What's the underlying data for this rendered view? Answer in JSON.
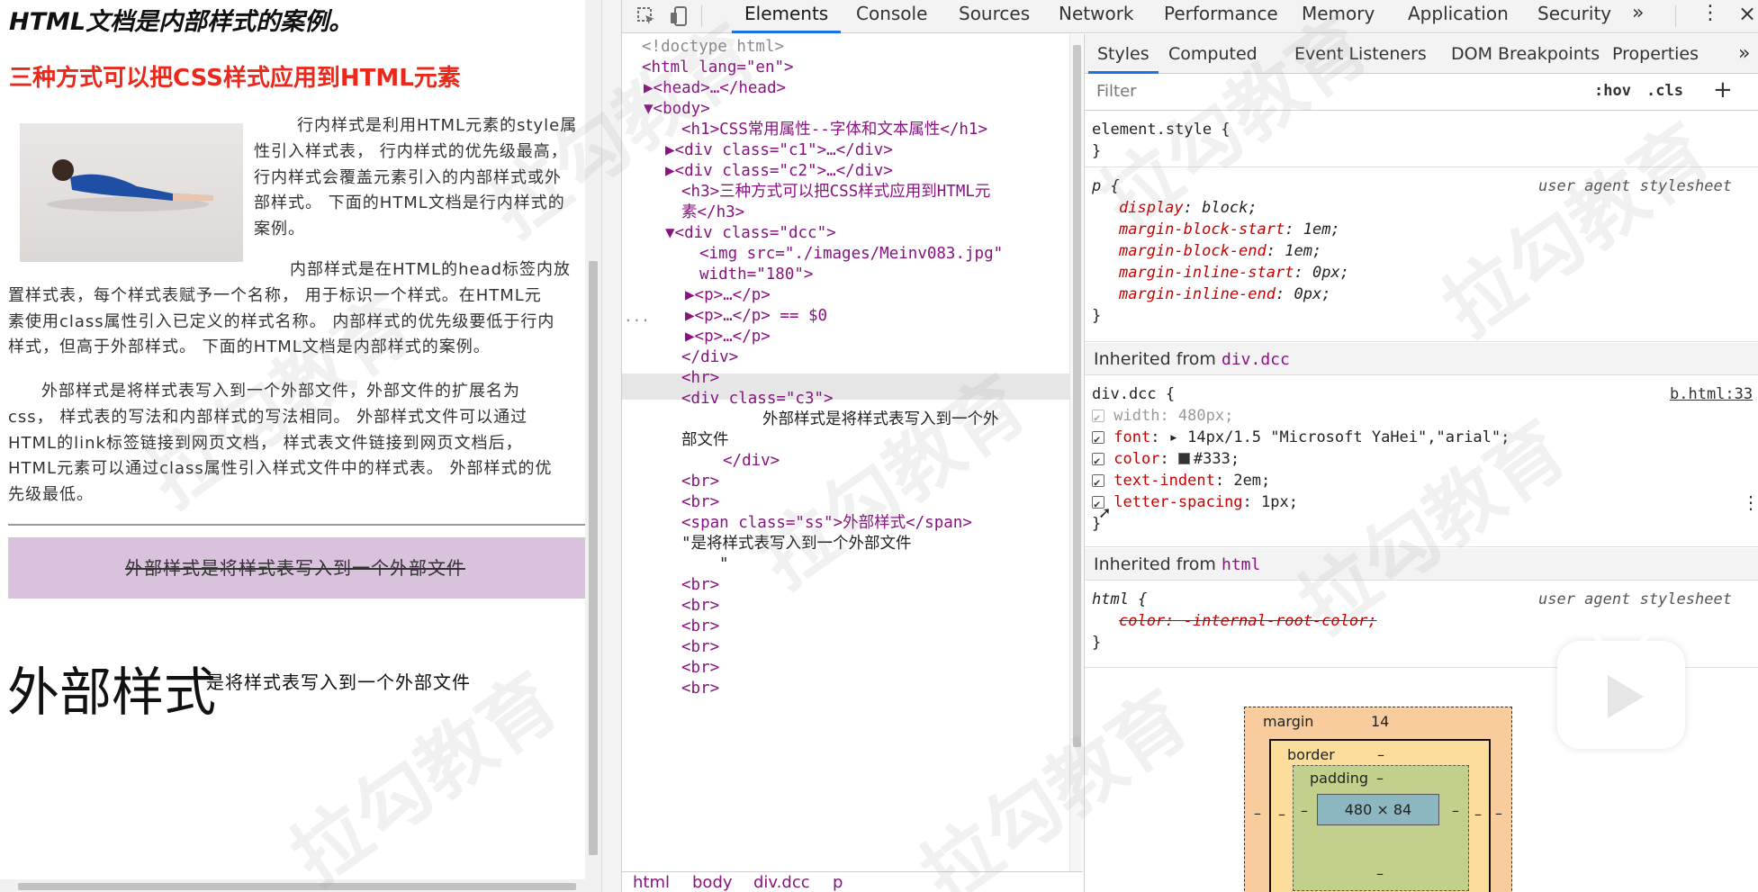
{
  "page": {
    "h1": "HTML文档是内部样式的案例。",
    "h3": "三种方式可以把CSS样式应用到HTML元素",
    "p1_lines": [
      "行内样式是利用HTML元素的style属",
      "性引入样式表， 行内样式的优先级最高，",
      "行内样式会覆盖元素引入的内部样式或外",
      "部样式。 下面的HTML文档是行内样式的",
      "案例。"
    ],
    "p2_lines": [
      "内部样式是在HTML的head标签内放",
      "置样式表，每个样式表赋予一个名称， 用于标识一个样式。在HTML元",
      "素使用class属性引入已定义的样式名称。 内部样式的优先级要低于行内",
      "样式，但高于外部样式。 下面的HTML文档是内部样式的案例。"
    ],
    "p3_lines": [
      "外部样式是将样式表写入到一个外部文件，外部文件的扩展名为",
      "css， 样式表的写法和内部样式的写法相同。 外部样式文件可以通过",
      "HTML的link标签链接到网页文档， 样式表文件链接到网页文档后，",
      "HTML元素可以通过class属性引入样式文件中的样式表。 外部样式的优",
      "先级最低。"
    ],
    "c3_text": "外部样式是将样式表写入到一个外部文件",
    "big_span": "外部样式",
    "big_after": "是将样式表写入到一个外部文件"
  },
  "toolbar": {
    "tabs": [
      "Elements",
      "Console",
      "Sources",
      "Network",
      "Performance",
      "Memory",
      "Application",
      "Security"
    ],
    "more": "»",
    "menu": "⋮",
    "close": "×"
  },
  "elements": {
    "lines": [
      {
        "t": "<!doctype html>",
        "cls": "cmt"
      },
      {
        "t": "<html lang=\"en\">"
      },
      {
        "t": "▶<head>…</head>"
      },
      {
        "t": "▼<body>"
      },
      {
        "t": "<h1>CSS常用属性--字体和文本属性</h1>"
      },
      {
        "t": "▶<div class=\"c1\">…</div>"
      },
      {
        "t": "▶<div class=\"c2\">…</div>"
      },
      {
        "t": "<h3>三种方式可以把CSS样式应用到HTML元"
      },
      {
        "t": "素</h3>"
      },
      {
        "t": "▼<div class=\"dcc\">"
      },
      {
        "t": "<img src=\"./images/Meinv083.jpg\""
      },
      {
        "t": "width=\"180\">"
      },
      {
        "t": "▶<p>…</p>"
      },
      {
        "t": "▶<p>…</p> == $0"
      },
      {
        "t": "▶<p>…</p>"
      },
      {
        "t": "</div>"
      },
      {
        "t": "<hr>"
      },
      {
        "t": "<div class=\"c3\">"
      },
      {
        "t": "外部样式是将样式表写入到一个外"
      },
      {
        "t": "部文件"
      },
      {
        "t": "</div>"
      },
      {
        "t": "<br>"
      },
      {
        "t": "<br>"
      },
      {
        "t": "<span class=\"ss\">外部样式</span>"
      },
      {
        "t": "\"是将样式表写入到一个外部文件"
      },
      {
        "t": "\""
      },
      {
        "t": "<br>"
      },
      {
        "t": "<br>"
      },
      {
        "t": "<br>"
      },
      {
        "t": "<br>"
      },
      {
        "t": "<br>"
      },
      {
        "t": "<br>"
      }
    ],
    "dots": "...",
    "crumbs": [
      "html",
      "body",
      "div.dcc",
      "p"
    ]
  },
  "styles": {
    "subtabs": [
      "Styles",
      "Computed",
      "Event Listeners",
      "DOM Breakpoints",
      "Properties"
    ],
    "subtabs_more": "»",
    "filter_placeholder": "Filter",
    "hov": ":hov",
    "cls": ".cls",
    "plus": "+",
    "element_style": "element.style {",
    "close_brace": "}",
    "p_rule_sel": "p {",
    "uas": "user agent stylesheet",
    "p_props": [
      {
        "name": "display",
        "value": "block;"
      },
      {
        "name": "margin-block-start",
        "value": "1em;"
      },
      {
        "name": "margin-block-end",
        "value": "1em;"
      },
      {
        "name": "margin-inline-start",
        "value": "0px;"
      },
      {
        "name": "margin-inline-end",
        "value": "0px;"
      }
    ],
    "inherited_label": "Inherited from",
    "inh_dcc": "div.dcc",
    "dcc_sel": "div.dcc {",
    "dcc_src": "b.html:33",
    "dcc_props": [
      {
        "name": "width",
        "value": "480px;"
      },
      {
        "name": "font",
        "value": "14px/1.5 \"Microsoft YaHei\",\"arial\";"
      },
      {
        "name": "color",
        "value": "#333;"
      },
      {
        "name": "text-indent",
        "value": "2em;"
      },
      {
        "name": "letter-spacing",
        "value": "1px;"
      }
    ],
    "inh_html": "html",
    "html_sel": "html {",
    "html_prop": "color: -internal-root-color;",
    "box": {
      "margin_label": "margin",
      "margin_value": "14",
      "border_label": "border",
      "border_value": "–",
      "padding_label": "padding",
      "padding_value": "–",
      "content": "480 × 84",
      "dash": "–"
    }
  },
  "watermark": "拉勾教育"
}
